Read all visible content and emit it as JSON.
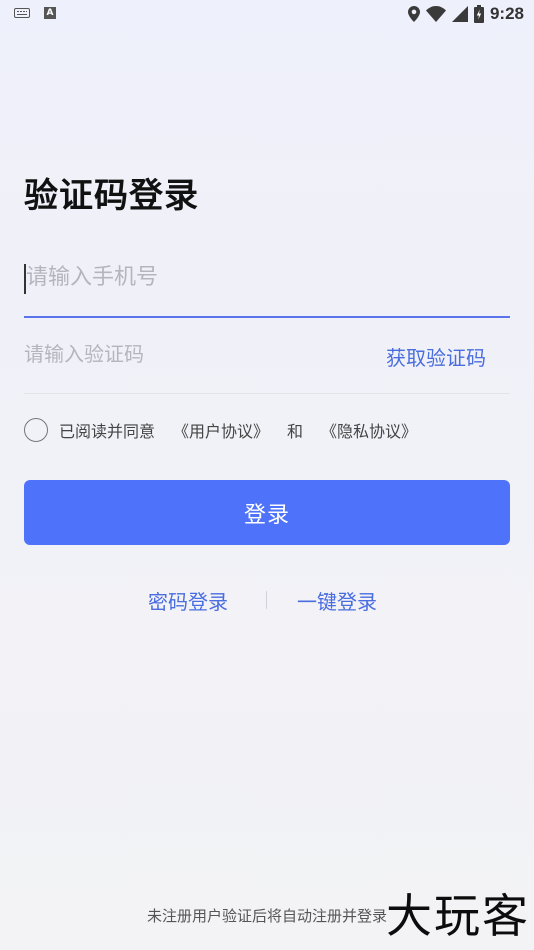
{
  "status_bar": {
    "time": "9:28",
    "left_icons": [
      "keyboard-icon",
      "font-icon"
    ],
    "right_icons": [
      "location-icon",
      "wifi-icon",
      "signal-icon",
      "battery-icon"
    ]
  },
  "page": {
    "title": "验证码登录"
  },
  "phone": {
    "placeholder": "请输入手机号",
    "value": ""
  },
  "code": {
    "placeholder": "请输入验证码",
    "value": "",
    "get_code_label": "获取验证码"
  },
  "agreement": {
    "checked": false,
    "prefix": "已阅读并同意",
    "user_agreement": "《用户协议》",
    "and": "和",
    "privacy_policy": "《隐私协议》"
  },
  "login_button": {
    "label": "登录"
  },
  "alt_login": {
    "password_login": "密码登录",
    "one_click_login": "一键登录"
  },
  "footer": {
    "note": "未注册用户验证后将自动注册并登录"
  },
  "watermark": {
    "text": "大玩客"
  },
  "colors": {
    "accent": "#4f72fb",
    "link": "#4a6ddf",
    "active_underline": "#5b74ee"
  }
}
